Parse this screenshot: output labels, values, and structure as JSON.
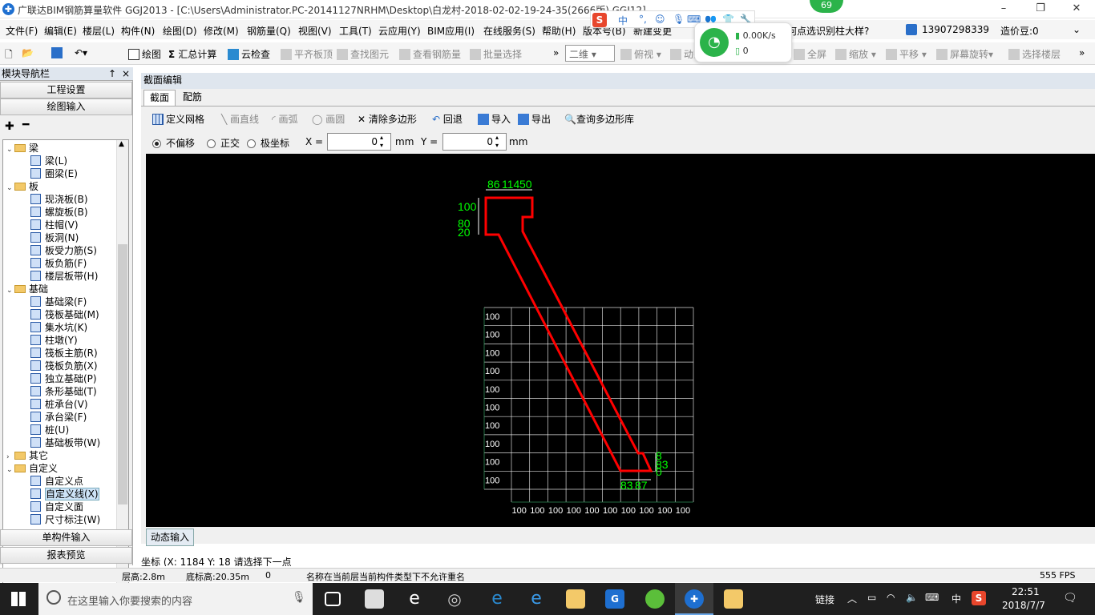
{
  "window": {
    "title": "广联达BIM钢筋算量软件 GGJ2013 - [C:\\Users\\Administrator.PC-20141127NRHM\\Desktop\\白龙村-2018-02-02-19-24-35(2666版).GGJ12]",
    "minimize": "–",
    "restore": "❐",
    "close": "✕"
  },
  "menu": {
    "items": [
      "文件(F)",
      "编辑(E)",
      "楼层(L)",
      "构件(N)",
      "绘图(D)",
      "修改(M)",
      "钢筋量(Q)",
      "视图(V)",
      "工具(T)",
      "云应用(Y)",
      "BIM应用(I)",
      "在线服务(S)",
      "帮助(H)",
      "版本号(B)"
    ],
    "new_change": "新建变更",
    "promo": "何点选识别柱大样?",
    "phone": "13907298339",
    "price_bean": "造价豆:0"
  },
  "toolbar": {
    "draw": "绘图",
    "sum": "汇总计算",
    "cloud_check": "云检查",
    "align_slab_top": "平齐板顶",
    "find_element": "查找图元",
    "view_rebar": "查看钢筋量",
    "batch_select": "批量选择",
    "view_mode": "二维",
    "top_view": "俯视",
    "dynamic": "动态",
    "fullscreen": "全屏",
    "zoom": "缩放",
    "pan": "平移",
    "rotate": "屏幕旋转",
    "select_floor": "选择楼层"
  },
  "left_panel": {
    "title": "模块导航栏",
    "pin": "↑",
    "close": "×",
    "project_settings": "工程设置",
    "drawing_input": "绘图输入",
    "single_input": "单构件输入",
    "report_preview": "报表预览",
    "tree": [
      {
        "label": "梁",
        "type": "folder",
        "level": 0
      },
      {
        "label": "梁(L)",
        "type": "item",
        "level": 1
      },
      {
        "label": "圈梁(E)",
        "type": "item",
        "level": 1
      },
      {
        "label": "板",
        "type": "folder",
        "level": 0
      },
      {
        "label": "现浇板(B)",
        "type": "item",
        "level": 1
      },
      {
        "label": "螺旋板(B)",
        "type": "item",
        "level": 1
      },
      {
        "label": "柱帽(V)",
        "type": "item",
        "level": 1
      },
      {
        "label": "板洞(N)",
        "type": "item",
        "level": 1
      },
      {
        "label": "板受力筋(S)",
        "type": "item",
        "level": 1
      },
      {
        "label": "板负筋(F)",
        "type": "item",
        "level": 1
      },
      {
        "label": "楼层板带(H)",
        "type": "item",
        "level": 1
      },
      {
        "label": "基础",
        "type": "folder",
        "level": 0
      },
      {
        "label": "基础梁(F)",
        "type": "item",
        "level": 1
      },
      {
        "label": "筏板基础(M)",
        "type": "item",
        "level": 1
      },
      {
        "label": "集水坑(K)",
        "type": "item",
        "level": 1
      },
      {
        "label": "柱墩(Y)",
        "type": "item",
        "level": 1
      },
      {
        "label": "筏板主筋(R)",
        "type": "item",
        "level": 1
      },
      {
        "label": "筏板负筋(X)",
        "type": "item",
        "level": 1
      },
      {
        "label": "独立基础(P)",
        "type": "item",
        "level": 1
      },
      {
        "label": "条形基础(T)",
        "type": "item",
        "level": 1
      },
      {
        "label": "桩承台(V)",
        "type": "item",
        "level": 1
      },
      {
        "label": "承台梁(F)",
        "type": "item",
        "level": 1
      },
      {
        "label": "桩(U)",
        "type": "item",
        "level": 1
      },
      {
        "label": "基础板带(W)",
        "type": "item",
        "level": 1
      },
      {
        "label": "其它",
        "type": "folder",
        "level": 0
      },
      {
        "label": "自定义",
        "type": "folder",
        "level": 0
      },
      {
        "label": "自定义点",
        "type": "item",
        "level": 1
      },
      {
        "label": "自定义线(X)",
        "type": "item",
        "level": 1
      },
      {
        "label": "自定义面",
        "type": "item",
        "level": 1
      },
      {
        "label": "尺寸标注(W)",
        "type": "item",
        "level": 1
      }
    ]
  },
  "editor": {
    "title": "截面编辑",
    "tab_section": "截面",
    "tab_rebar": "配筋",
    "define_grid": "定义网格",
    "draw_line": "画直线",
    "draw_arc": "画弧",
    "draw_circle": "画圆",
    "clear_polygon": "清除多边形",
    "undo": "回退",
    "import": "导入",
    "export": "导出",
    "query_library": "查询多边形库",
    "no_offset": "不偏移",
    "ortho": "正交",
    "polar": "极坐标",
    "x_label": "X =",
    "y_label": "Y =",
    "x_value": "0",
    "y_value": "0",
    "unit": "mm"
  },
  "canvas": {
    "top_dims": [
      "86",
      "114",
      "50"
    ],
    "left_dims": [
      "100",
      "80",
      "20"
    ],
    "bottom_dims": [
      "83",
      "87"
    ],
    "right_dims": [
      "8",
      "83",
      "0"
    ],
    "grid_row_label": "100",
    "grid_col_label": "100",
    "grid_rows": 10,
    "grid_cols": 10,
    "colors": {
      "outline": "#ff0000",
      "dim": "#00ff00",
      "grid": "#ffffff"
    }
  },
  "dynamic_input": "动态输入",
  "coord_line": "坐标 (X: 1184 Y: 18  请选择下一点",
  "status": {
    "floor_height": "层高:2.8m",
    "bottom_height": "底标高:20.35m",
    "zero": "0",
    "message": "名称在当前层当前构件类型下不允许重名",
    "fps": "555 FPS"
  },
  "overlays": {
    "badge": "69",
    "wifi_speed": "0.00K/s",
    "wifi_count": "0",
    "ime_mode": "中"
  },
  "taskbar": {
    "search_placeholder": "在这里输入你要搜索的内容",
    "link": "链接",
    "ime": "中",
    "time": "22:51",
    "date": "2018/7/7"
  }
}
